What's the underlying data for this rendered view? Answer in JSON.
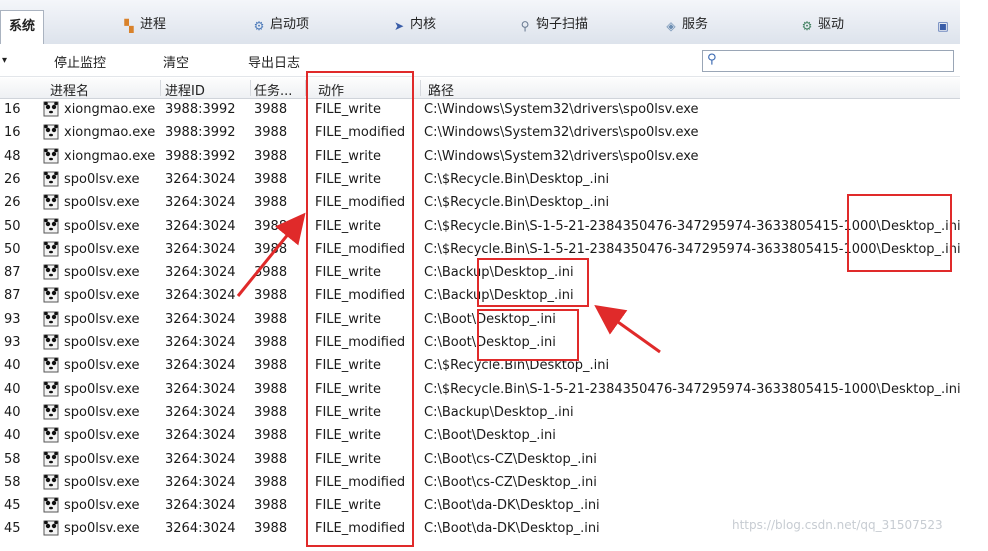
{
  "tabs": [
    {
      "label": "系统",
      "icon": "none"
    },
    {
      "label": "进程",
      "icon": "process-icon"
    },
    {
      "label": "启动项",
      "icon": "startup-icon"
    },
    {
      "label": "内核",
      "icon": "kernel-icon"
    },
    {
      "label": "钩子扫描",
      "icon": "hook-icon"
    },
    {
      "label": "服务",
      "icon": "service-icon"
    },
    {
      "label": "驱动",
      "icon": "driver-icon"
    }
  ],
  "toolbar": {
    "stop_label": "停止监控",
    "clear_label": "清空",
    "export_label": "导出日志",
    "search_value": ""
  },
  "columns": [
    "进程名",
    "进程ID",
    "任务...",
    "动作",
    "路径"
  ],
  "rows": [
    {
      "idx": "16",
      "name": "xiongmao.exe",
      "pid": "3988:3992",
      "task": "3988",
      "action": "FILE_write",
      "path": "C:\\Windows\\System32\\drivers\\spo0lsv.exe"
    },
    {
      "idx": "16",
      "name": "xiongmao.exe",
      "pid": "3988:3992",
      "task": "3988",
      "action": "FILE_modified",
      "path": "C:\\Windows\\System32\\drivers\\spo0lsv.exe"
    },
    {
      "idx": "48",
      "name": "xiongmao.exe",
      "pid": "3988:3992",
      "task": "3988",
      "action": "FILE_write",
      "path": "C:\\Windows\\System32\\drivers\\spo0lsv.exe"
    },
    {
      "idx": "26",
      "name": "spo0lsv.exe",
      "pid": "3264:3024",
      "task": "3988",
      "action": "FILE_write",
      "path": "C:\\$Recycle.Bin\\Desktop_.ini"
    },
    {
      "idx": "26",
      "name": "spo0lsv.exe",
      "pid": "3264:3024",
      "task": "3988",
      "action": "FILE_modified",
      "path": "C:\\$Recycle.Bin\\Desktop_.ini"
    },
    {
      "idx": "50",
      "name": "spo0lsv.exe",
      "pid": "3264:3024",
      "task": "3988",
      "action": "FILE_write",
      "path": "C:\\$Recycle.Bin\\S-1-5-21-2384350476-347295974-3633805415-1000\\Desktop_.ini"
    },
    {
      "idx": "50",
      "name": "spo0lsv.exe",
      "pid": "3264:3024",
      "task": "3988",
      "action": "FILE_modified",
      "path": "C:\\$Recycle.Bin\\S-1-5-21-2384350476-347295974-3633805415-1000\\Desktop_.ini"
    },
    {
      "idx": "87",
      "name": "spo0lsv.exe",
      "pid": "3264:3024",
      "task": "3988",
      "action": "FILE_write",
      "path": "C:\\Backup\\Desktop_.ini"
    },
    {
      "idx": "87",
      "name": "spo0lsv.exe",
      "pid": "3264:3024",
      "task": "3988",
      "action": "FILE_modified",
      "path": "C:\\Backup\\Desktop_.ini"
    },
    {
      "idx": "93",
      "name": "spo0lsv.exe",
      "pid": "3264:3024",
      "task": "3988",
      "action": "FILE_write",
      "path": "C:\\Boot\\Desktop_.ini"
    },
    {
      "idx": "93",
      "name": "spo0lsv.exe",
      "pid": "3264:3024",
      "task": "3988",
      "action": "FILE_modified",
      "path": "C:\\Boot\\Desktop_.ini"
    },
    {
      "idx": "40",
      "name": "spo0lsv.exe",
      "pid": "3264:3024",
      "task": "3988",
      "action": "FILE_write",
      "path": "C:\\$Recycle.Bin\\Desktop_.ini"
    },
    {
      "idx": "40",
      "name": "spo0lsv.exe",
      "pid": "3264:3024",
      "task": "3988",
      "action": "FILE_write",
      "path": "C:\\$Recycle.Bin\\S-1-5-21-2384350476-347295974-3633805415-1000\\Desktop_.ini"
    },
    {
      "idx": "40",
      "name": "spo0lsv.exe",
      "pid": "3264:3024",
      "task": "3988",
      "action": "FILE_write",
      "path": "C:\\Backup\\Desktop_.ini"
    },
    {
      "idx": "40",
      "name": "spo0lsv.exe",
      "pid": "3264:3024",
      "task": "3988",
      "action": "FILE_write",
      "path": "C:\\Boot\\Desktop_.ini"
    },
    {
      "idx": "58",
      "name": "spo0lsv.exe",
      "pid": "3264:3024",
      "task": "3988",
      "action": "FILE_write",
      "path": "C:\\Boot\\cs-CZ\\Desktop_.ini"
    },
    {
      "idx": "58",
      "name": "spo0lsv.exe",
      "pid": "3264:3024",
      "task": "3988",
      "action": "FILE_modified",
      "path": "C:\\Boot\\cs-CZ\\Desktop_.ini"
    },
    {
      "idx": "45",
      "name": "spo0lsv.exe",
      "pid": "3264:3024",
      "task": "3988",
      "action": "FILE_write",
      "path": "C:\\Boot\\da-DK\\Desktop_.ini"
    },
    {
      "idx": "45",
      "name": "spo0lsv.exe",
      "pid": "3264:3024",
      "task": "3988",
      "action": "FILE_modified",
      "path": "C:\\Boot\\da-DK\\Desktop_.ini"
    }
  ],
  "watermark": "https://blog.csdn.net/qq_31507523",
  "colors": {
    "annotation": "#e02a2a",
    "tab_bg": "#dde3ec"
  }
}
